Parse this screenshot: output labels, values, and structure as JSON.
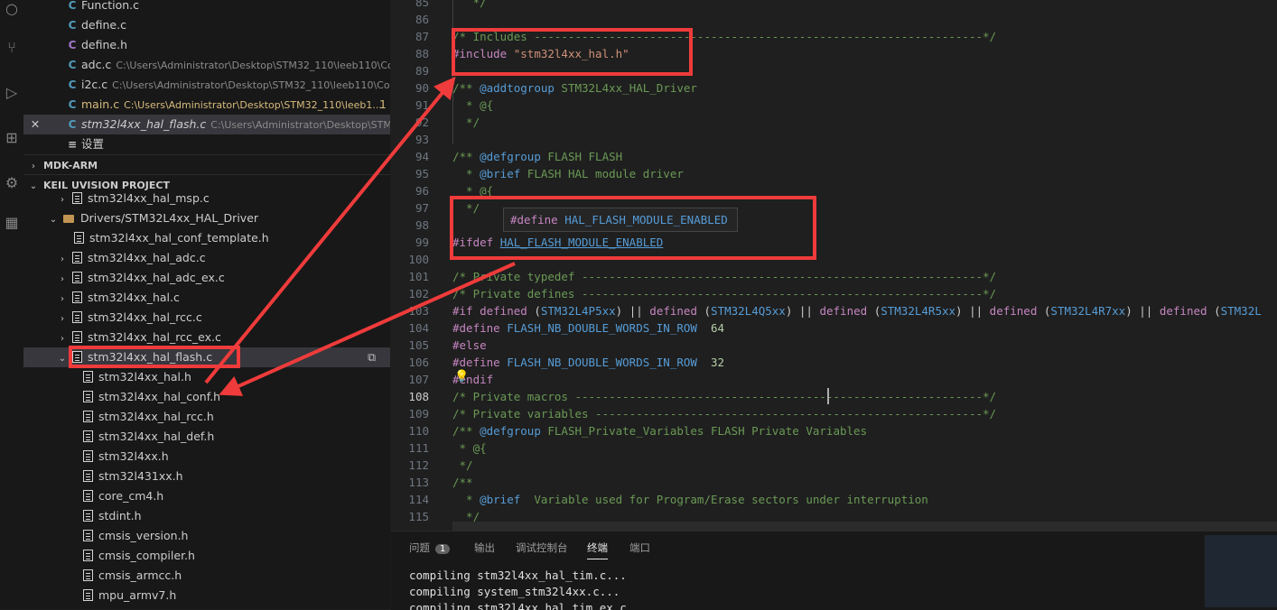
{
  "open_editors": [
    {
      "icon": "c",
      "name": "Function.c",
      "path": "",
      "extra": ""
    },
    {
      "icon": "c",
      "name": "define.c",
      "path": "",
      "extra": ""
    },
    {
      "icon": "h",
      "name": "define.h",
      "path": "",
      "extra": ""
    },
    {
      "icon": "c",
      "name": "adc.c",
      "path": "C:\\Users\\Administrator\\Desktop\\STM32_110\\leeb110\\Cor...",
      "extra": ""
    },
    {
      "icon": "c",
      "name": "i2c.c",
      "path": "C:\\Users\\Administrator\\Desktop\\STM32_110\\leeb110\\Cor...",
      "extra": ""
    },
    {
      "icon": "c",
      "name": "main.c",
      "path": "C:\\Users\\Administrator\\Desktop\\STM32_110\\leeb1...",
      "extra": "1"
    },
    {
      "icon": "c",
      "name": "stm32l4xx_hal_flash.c",
      "path": "C:\\Users\\Administrator\\Desktop\\STM32_...",
      "extra": ""
    },
    {
      "icon": "settings",
      "name": "设置",
      "path": "",
      "extra": ""
    }
  ],
  "sections": {
    "mdk": "MDK-ARM",
    "keil": "KEIL UVISION PROJECT"
  },
  "tree": [
    {
      "label": "stm32l4xx_hal_msp.c"
    },
    {
      "label": "Drivers/STM32L4xx_HAL_Driver"
    },
    {
      "label": "stm32l4xx_hal_conf_template.h"
    },
    {
      "label": "stm32l4xx_hal_adc.c"
    },
    {
      "label": "stm32l4xx_hal_adc_ex.c"
    },
    {
      "label": "stm32l4xx_hal.c"
    },
    {
      "label": "stm32l4xx_hal_rcc.c"
    },
    {
      "label": "stm32l4xx_hal_rcc_ex.c"
    },
    {
      "label": "stm32l4xx_hal_flash.c"
    },
    {
      "label": "stm32l4xx_hal.h"
    },
    {
      "label": "stm32l4xx_hal_conf.h"
    },
    {
      "label": "stm32l4xx_hal_rcc.h"
    },
    {
      "label": "stm32l4xx_hal_def.h"
    },
    {
      "label": "stm32l4xx.h"
    },
    {
      "label": "stm32l431xx.h"
    },
    {
      "label": "core_cm4.h"
    },
    {
      "label": "stdint.h"
    },
    {
      "label": "cmsis_version.h"
    },
    {
      "label": "cmsis_compiler.h"
    },
    {
      "label": "cmsis_armcc.h"
    },
    {
      "label": "mpu_armv7.h"
    }
  ],
  "code": {
    "l85": {
      "n": "85",
      "t": "   */"
    },
    "l87": {
      "n": "87",
      "t": "/* Includes ------------------------------------------------------------------*/"
    },
    "l88": {
      "n": "88",
      "kw": "#include",
      "s": "\"stm32l4xx_hal.h\""
    },
    "l90": {
      "n": "90",
      "a": "/** ",
      "tag": "@addtogroup",
      "b": " STM32L4xx_HAL_Driver"
    },
    "l91": {
      "n": "91",
      "t": "  * @{"
    },
    "l92": {
      "n": "92",
      "t": "  */"
    },
    "l94": {
      "n": "94",
      "a": "/** ",
      "tag": "@defgroup",
      "b": " FLASH FLASH"
    },
    "l95": {
      "n": "95",
      "a": "  * ",
      "tag": "@brief",
      "b": " FLASH HAL module driver"
    },
    "l96": {
      "n": "96",
      "t": "  * @{"
    },
    "l97": {
      "n": "97",
      "t": "  */"
    },
    "l98": {
      "n": "98"
    },
    "l99": {
      "n": "99",
      "kw": "#ifdef",
      "m": "HAL_FLASH_MODULE_ENABLED"
    },
    "l100": {
      "n": "100"
    },
    "l101": {
      "n": "101",
      "t": "/* Private typedef -----------------------------------------------------------*/"
    },
    "l102": {
      "n": "102",
      "t": "/* Private defines -----------------------------------------------------------*/"
    },
    "l103": {
      "n": "103",
      "kw": "#if",
      "d1": "defined",
      "m1": "STM32L4P5xx",
      "d2": "defined",
      "m2": "STM32L4Q5xx",
      "d3": "defined",
      "m3": "STM32L4R5xx",
      "d4": "defined",
      "m4": "STM32L4R7xx",
      "d5": "defined",
      "m5": "STM32L"
    },
    "l104": {
      "n": "104",
      "kw": "#define",
      "m": "FLASH_NB_DOUBLE_WORDS_IN_ROW",
      "v": "64"
    },
    "l105": {
      "n": "105",
      "kw": "#else"
    },
    "l106": {
      "n": "106",
      "kw": "#define",
      "m": "FLASH_NB_DOUBLE_WORDS_IN_ROW",
      "v": "32"
    },
    "l107": {
      "n": "107",
      "kw": "#endif"
    },
    "l108": {
      "n": "108",
      "t": "/* Private macros ------------------------------------------------------------*/"
    },
    "l109": {
      "n": "109",
      "t": "/* Private variables ---------------------------------------------------------*/"
    },
    "l110": {
      "n": "110",
      "a": "/** ",
      "tag": "@defgroup",
      "b": " FLASH_Private_Variables FLASH Private Variables"
    },
    "l111": {
      "n": "111",
      "t": " * @{"
    },
    "l112": {
      "n": "112",
      "t": " */"
    },
    "l113": {
      "n": "113",
      "t": "/**"
    },
    "l114": {
      "n": "114",
      "a": "  * ",
      "tag": "@brief",
      "b": "  Variable used for Program/Erase sectors under interruption"
    },
    "l115": {
      "n": "115",
      "t": "  */"
    }
  },
  "tooltip": {
    "kw": "#define",
    "m": "HAL_FLASH_MODULE_ENABLED"
  },
  "panel": {
    "tabs": [
      "问题",
      "输出",
      "调试控制台",
      "终端",
      "端口"
    ],
    "problems_count": "1",
    "lines": [
      "compiling stm32l4xx_hal_tim.c...",
      "compiling system_stm32l4xx.c...",
      "compiling stm32l4xx_hal_tim_ex.c..."
    ]
  },
  "colors": {
    "annotation": "#ef3b3b",
    "accent": "#569cd6"
  }
}
